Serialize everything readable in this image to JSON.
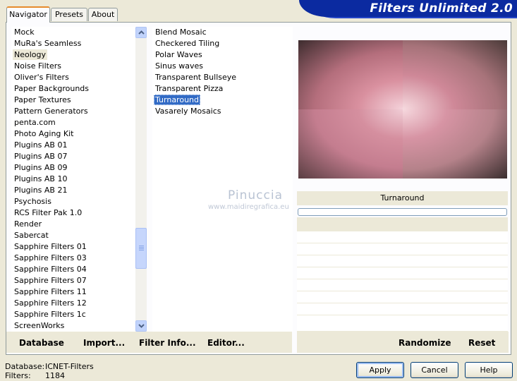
{
  "banner": {
    "title": "Filters Unlimited 2.0"
  },
  "tabs": [
    {
      "label": "Navigator",
      "active": true
    },
    {
      "label": "Presets",
      "active": false
    },
    {
      "label": "About",
      "active": false
    }
  ],
  "categories": {
    "items": [
      "Mock",
      "MuRa's Seamless",
      "Neology",
      "Noise Filters",
      "Oliver's Filters",
      "Paper Backgrounds",
      "Paper Textures",
      "Pattern Generators",
      "penta.com",
      "Photo Aging Kit",
      "Plugins AB 01",
      "Plugins AB 07",
      "Plugins AB 09",
      "Plugins AB 10",
      "Plugins AB 21",
      "Psychosis",
      "RCS Filter Pak 1.0",
      "Render",
      "Sabercat",
      "Sapphire Filters 01",
      "Sapphire Filters 03",
      "Sapphire Filters 04",
      "Sapphire Filters 07",
      "Sapphire Filters 11",
      "Sapphire Filters 12",
      "Sapphire Filters 1c",
      "ScreenWorks"
    ],
    "selected_index": 2
  },
  "filters": {
    "items": [
      "Blend Mosaic",
      "Checkered Tiling",
      "Polar Waves",
      "Sinus waves",
      "Transparent Bullseye",
      "Transparent Pizza",
      "Turnaround",
      "Vasarely Mosaics"
    ],
    "selected_index": 6
  },
  "preview": {
    "filter_name": "Turnaround",
    "progress": 0
  },
  "toolbar": {
    "database": "Database",
    "import": "Import...",
    "filter_info": "Filter Info...",
    "editor": "Editor...",
    "randomize": "Randomize",
    "reset": "Reset"
  },
  "watermark": {
    "name": "Pinuccia",
    "site": "www.maidiregrafica.eu"
  },
  "footer": {
    "database_label": "Database:",
    "database_value": "ICNET-Filters",
    "filters_label": "Filters:",
    "filters_value": "1184"
  },
  "buttons": {
    "apply": "Apply",
    "cancel": "Cancel",
    "help": "Help"
  },
  "colors": {
    "banner": "#0b2aa0",
    "selection": "#316ac5",
    "preview_pink": "#c98896"
  }
}
